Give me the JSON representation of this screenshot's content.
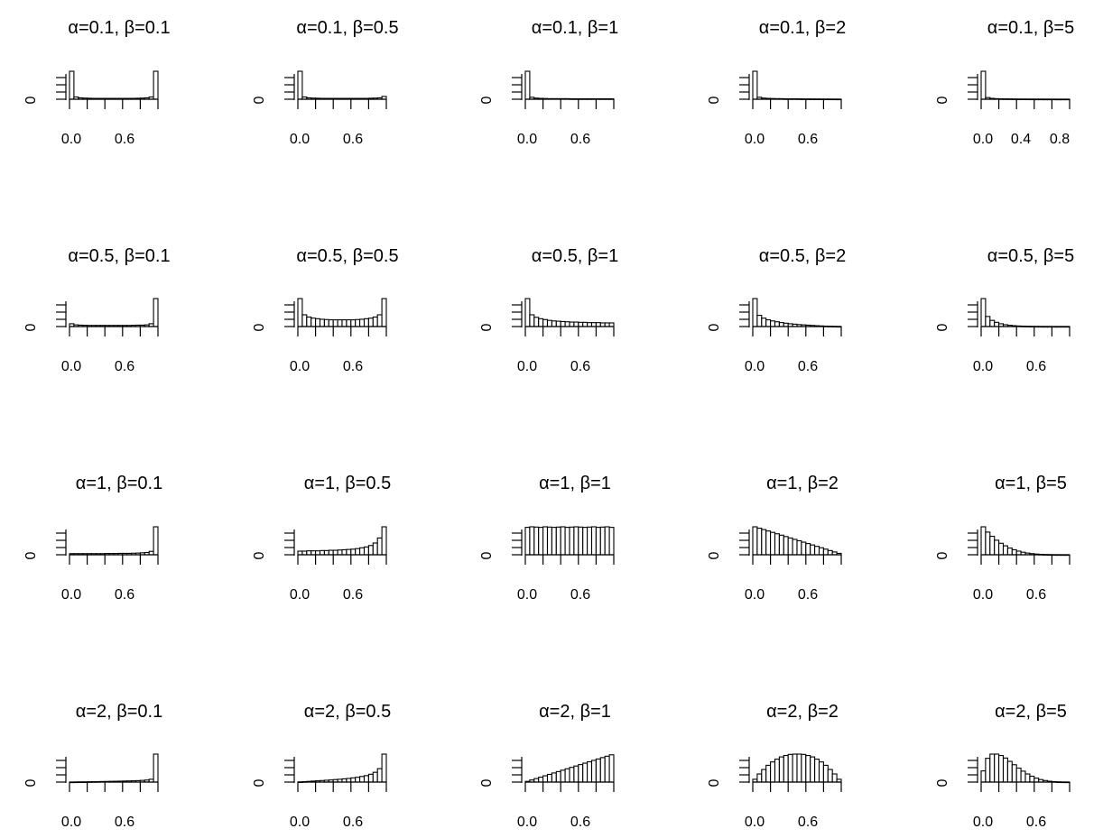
{
  "chart_data": [
    {
      "type": "bar",
      "title": "α=0.1, β=0.1",
      "x_ticks": [
        "0.0",
        "0.6"
      ],
      "ylabel": "0",
      "bins": 20,
      "values": [
        1.0,
        0.08,
        0.05,
        0.04,
        0.035,
        0.03,
        0.03,
        0.03,
        0.03,
        0.03,
        0.03,
        0.03,
        0.03,
        0.03,
        0.03,
        0.035,
        0.04,
        0.05,
        0.08,
        1.0
      ]
    },
    {
      "type": "bar",
      "title": "α=0.1, β=0.5",
      "x_ticks": [
        "0.0",
        "0.6"
      ],
      "ylabel": "0",
      "bins": 20,
      "values": [
        1.0,
        0.08,
        0.05,
        0.04,
        0.035,
        0.03,
        0.03,
        0.03,
        0.03,
        0.03,
        0.03,
        0.03,
        0.03,
        0.03,
        0.03,
        0.03,
        0.035,
        0.04,
        0.05,
        0.1
      ]
    },
    {
      "type": "bar",
      "title": "α=0.1, β=1",
      "x_ticks": [
        "0.0",
        "0.6"
      ],
      "ylabel": "0",
      "bins": 20,
      "values": [
        1.0,
        0.07,
        0.04,
        0.03,
        0.025,
        0.02,
        0.02,
        0.02,
        0.02,
        0.02,
        0.015,
        0.015,
        0.015,
        0.015,
        0.015,
        0.015,
        0.015,
        0.015,
        0.015,
        0.015
      ]
    },
    {
      "type": "bar",
      "title": "α=0.1, β=2",
      "x_ticks": [
        "0.0",
        "0.6"
      ],
      "ylabel": "0",
      "bins": 20,
      "values": [
        1.0,
        0.07,
        0.04,
        0.03,
        0.025,
        0.02,
        0.02,
        0.015,
        0.015,
        0.015,
        0.012,
        0.01,
        0.01,
        0.008,
        0.007,
        0.006,
        0.005,
        0.004,
        0.003,
        0.002
      ]
    },
    {
      "type": "bar",
      "title": "α=0.1, β=5",
      "x_ticks": [
        "0.0",
        "0.4",
        "0.8"
      ],
      "ylabel": "0",
      "bins": 20,
      "values": [
        1.0,
        0.06,
        0.03,
        0.02,
        0.015,
        0.012,
        0.01,
        0.008,
        0.006,
        0.005,
        0.004,
        0.003,
        0.002,
        0.002,
        0.001,
        0.001,
        0.001,
        0.0,
        0.0,
        0.0
      ]
    },
    {
      "type": "bar",
      "title": "α=0.5, β=0.1",
      "x_ticks": [
        "0.0",
        "0.6"
      ],
      "ylabel": "0",
      "bins": 20,
      "values": [
        0.1,
        0.06,
        0.05,
        0.045,
        0.04,
        0.04,
        0.04,
        0.04,
        0.04,
        0.04,
        0.04,
        0.04,
        0.04,
        0.04,
        0.045,
        0.05,
        0.05,
        0.06,
        0.1,
        1.0
      ]
    },
    {
      "type": "bar",
      "title": "α=0.5, β=0.5",
      "x_ticks": [
        "0.0",
        "0.6"
      ],
      "ylabel": "0",
      "bins": 20,
      "values": [
        1.0,
        0.42,
        0.34,
        0.3,
        0.28,
        0.26,
        0.25,
        0.24,
        0.24,
        0.24,
        0.24,
        0.24,
        0.24,
        0.25,
        0.26,
        0.28,
        0.3,
        0.34,
        0.42,
        1.0
      ]
    },
    {
      "type": "bar",
      "title": "α=0.5, β=1",
      "x_ticks": [
        "0.0",
        "0.6"
      ],
      "ylabel": "0",
      "bins": 20,
      "values": [
        1.0,
        0.42,
        0.33,
        0.28,
        0.25,
        0.22,
        0.2,
        0.19,
        0.18,
        0.17,
        0.16,
        0.16,
        0.15,
        0.15,
        0.14,
        0.14,
        0.14,
        0.13,
        0.13,
        0.13
      ]
    },
    {
      "type": "bar",
      "title": "α=0.5, β=2",
      "x_ticks": [
        "0.0",
        "0.6"
      ],
      "ylabel": "0",
      "bins": 20,
      "values": [
        1.0,
        0.4,
        0.3,
        0.24,
        0.2,
        0.17,
        0.14,
        0.12,
        0.1,
        0.085,
        0.07,
        0.06,
        0.05,
        0.04,
        0.03,
        0.022,
        0.015,
        0.01,
        0.005,
        0.002
      ]
    },
    {
      "type": "bar",
      "title": "α=0.5, β=5",
      "x_ticks": [
        "0.0",
        "0.6"
      ],
      "ylabel": "0",
      "bins": 20,
      "values": [
        1.0,
        0.36,
        0.22,
        0.15,
        0.1,
        0.065,
        0.045,
        0.03,
        0.02,
        0.013,
        0.008,
        0.005,
        0.003,
        0.002,
        0.001,
        0.0,
        0.0,
        0.0,
        0.0,
        0.0
      ]
    },
    {
      "type": "bar",
      "title": "α=1, β=0.1",
      "x_ticks": [
        "0.0",
        "0.6"
      ],
      "ylabel": "0",
      "bins": 20,
      "values": [
        0.04,
        0.04,
        0.04,
        0.04,
        0.04,
        0.04,
        0.04,
        0.04,
        0.045,
        0.045,
        0.045,
        0.05,
        0.05,
        0.05,
        0.055,
        0.06,
        0.07,
        0.08,
        0.12,
        1.0
      ]
    },
    {
      "type": "bar",
      "title": "α=1, β=0.5",
      "x_ticks": [
        "0.0",
        "0.6"
      ],
      "ylabel": "0",
      "bins": 20,
      "values": [
        0.13,
        0.13,
        0.14,
        0.14,
        0.14,
        0.15,
        0.15,
        0.16,
        0.16,
        0.17,
        0.18,
        0.19,
        0.2,
        0.22,
        0.25,
        0.28,
        0.33,
        0.42,
        0.6,
        1.0
      ]
    },
    {
      "type": "bar",
      "title": "α=1, β=1",
      "x_ticks": [
        "0.0",
        "0.6"
      ],
      "ylabel": "0",
      "bins": 20,
      "values": [
        0.98,
        1.0,
        0.99,
        0.98,
        1.0,
        0.99,
        0.98,
        0.99,
        1.0,
        0.98,
        0.99,
        1.0,
        0.99,
        0.98,
        0.99,
        1.0,
        0.98,
        0.99,
        1.0,
        0.98
      ]
    },
    {
      "type": "bar",
      "title": "α=1, β=2",
      "x_ticks": [
        "0.0",
        "0.6"
      ],
      "ylabel": "0",
      "bins": 20,
      "values": [
        1.0,
        0.95,
        0.9,
        0.85,
        0.8,
        0.75,
        0.7,
        0.65,
        0.6,
        0.55,
        0.5,
        0.45,
        0.4,
        0.35,
        0.3,
        0.25,
        0.2,
        0.15,
        0.1,
        0.05
      ]
    },
    {
      "type": "bar",
      "title": "α=1, β=5",
      "x_ticks": [
        "0.0",
        "0.6"
      ],
      "ylabel": "0",
      "bins": 20,
      "values": [
        1.0,
        0.81,
        0.66,
        0.52,
        0.41,
        0.32,
        0.24,
        0.18,
        0.13,
        0.09,
        0.06,
        0.04,
        0.025,
        0.015,
        0.008,
        0.004,
        0.002,
        0.001,
        0.0,
        0.0
      ]
    },
    {
      "type": "bar",
      "title": "α=2, β=0.1",
      "x_ticks": [
        "0.0",
        "0.6"
      ],
      "ylabel": "0",
      "bins": 20,
      "values": [
        0.0,
        0.002,
        0.005,
        0.008,
        0.01,
        0.013,
        0.016,
        0.02,
        0.023,
        0.026,
        0.03,
        0.033,
        0.037,
        0.041,
        0.046,
        0.052,
        0.06,
        0.072,
        0.1,
        1.0
      ]
    },
    {
      "type": "bar",
      "title": "α=2, β=0.5",
      "x_ticks": [
        "0.0",
        "0.6"
      ],
      "ylabel": "0",
      "bins": 20,
      "values": [
        0.005,
        0.015,
        0.025,
        0.035,
        0.045,
        0.055,
        0.065,
        0.075,
        0.09,
        0.1,
        0.115,
        0.13,
        0.15,
        0.17,
        0.2,
        0.23,
        0.28,
        0.35,
        0.48,
        1.0
      ]
    },
    {
      "type": "bar",
      "title": "α=2, β=1",
      "x_ticks": [
        "0.0",
        "0.6"
      ],
      "ylabel": "0",
      "bins": 20,
      "values": [
        0.025,
        0.075,
        0.125,
        0.175,
        0.225,
        0.275,
        0.325,
        0.375,
        0.425,
        0.475,
        0.525,
        0.575,
        0.625,
        0.675,
        0.725,
        0.775,
        0.825,
        0.875,
        0.925,
        0.975
      ]
    },
    {
      "type": "bar",
      "title": "α=2, β=2",
      "x_ticks": [
        "0.0",
        "0.6"
      ],
      "ylabel": "0",
      "bins": 20,
      "values": [
        0.1,
        0.29,
        0.45,
        0.6,
        0.72,
        0.82,
        0.9,
        0.95,
        0.99,
        1.0,
        1.0,
        0.99,
        0.95,
        0.9,
        0.82,
        0.72,
        0.6,
        0.45,
        0.29,
        0.1
      ]
    },
    {
      "type": "bar",
      "title": "α=2, β=5",
      "x_ticks": [
        "0.0",
        "0.6"
      ],
      "ylabel": "0",
      "bins": 20,
      "values": [
        0.4,
        0.85,
        1.0,
        1.0,
        0.95,
        0.86,
        0.74,
        0.62,
        0.5,
        0.39,
        0.29,
        0.21,
        0.14,
        0.09,
        0.055,
        0.03,
        0.015,
        0.006,
        0.002,
        0.0
      ]
    }
  ]
}
